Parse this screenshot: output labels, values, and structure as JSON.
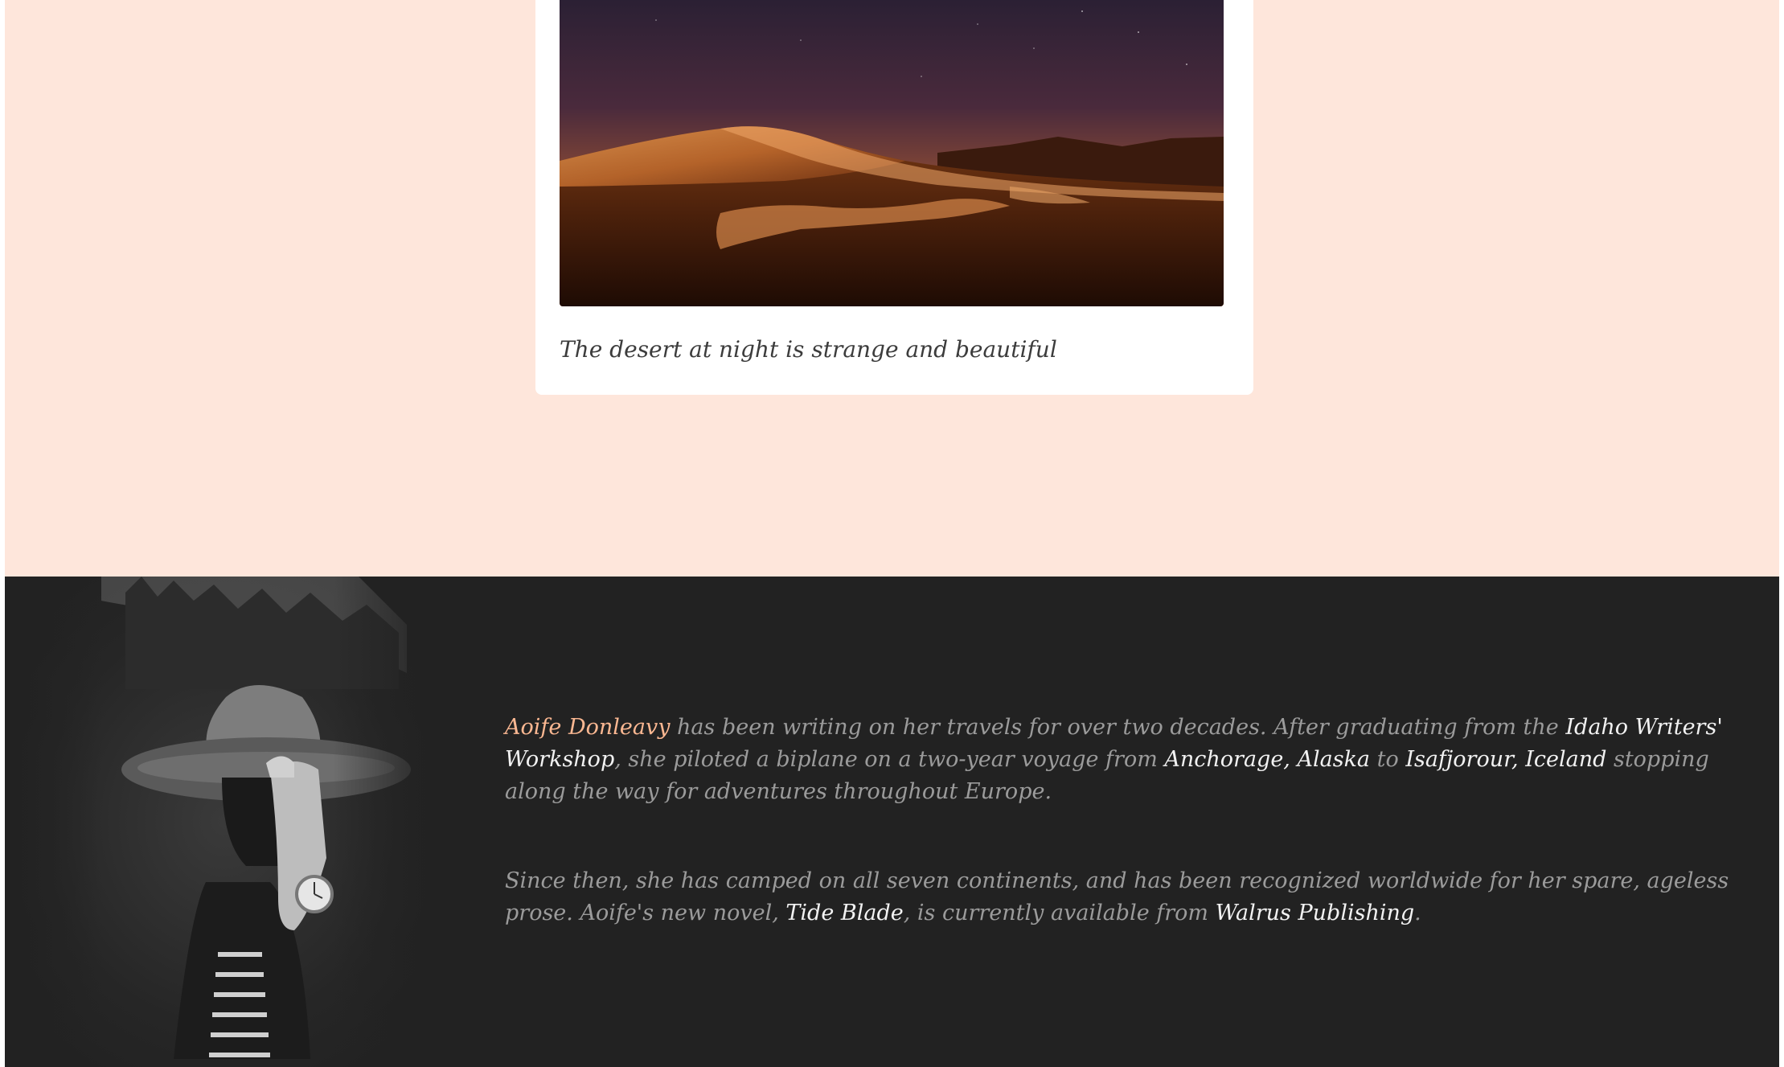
{
  "photo_card": {
    "image_alt": "Sand dunes in the desert at night",
    "caption": "The desert at night is strange and beautiful"
  },
  "bio": {
    "portrait_alt": "Portrait of a woman holding the brim of her hat",
    "paragraph1": {
      "name": "Aoife Donleavy",
      "t1": " has been writing on her travels for over two decades. After graduating from the ",
      "workshop": "Idaho Writers' Workshop",
      "t2": ", she piloted a biplane on a two-year voyage from ",
      "from_place": "Anchorage, Alaska",
      "t3": " to ",
      "to_place": "Isafjorour, Iceland",
      "t4": " stopping along the way for adventures throughout Europe."
    },
    "paragraph2": {
      "t1": "Since then, she has camped on all seven continents, and has been recognized worldwide for her spare, ageless prose. Aoife's new novel, ",
      "novel": "Tide Blade",
      "t2": ", is currently available from ",
      "publisher": "Walrus Publishing",
      "t3": "."
    }
  },
  "colors": {
    "page_background": "#fee6db",
    "bio_background": "#222222",
    "accent": "#fcb892"
  }
}
